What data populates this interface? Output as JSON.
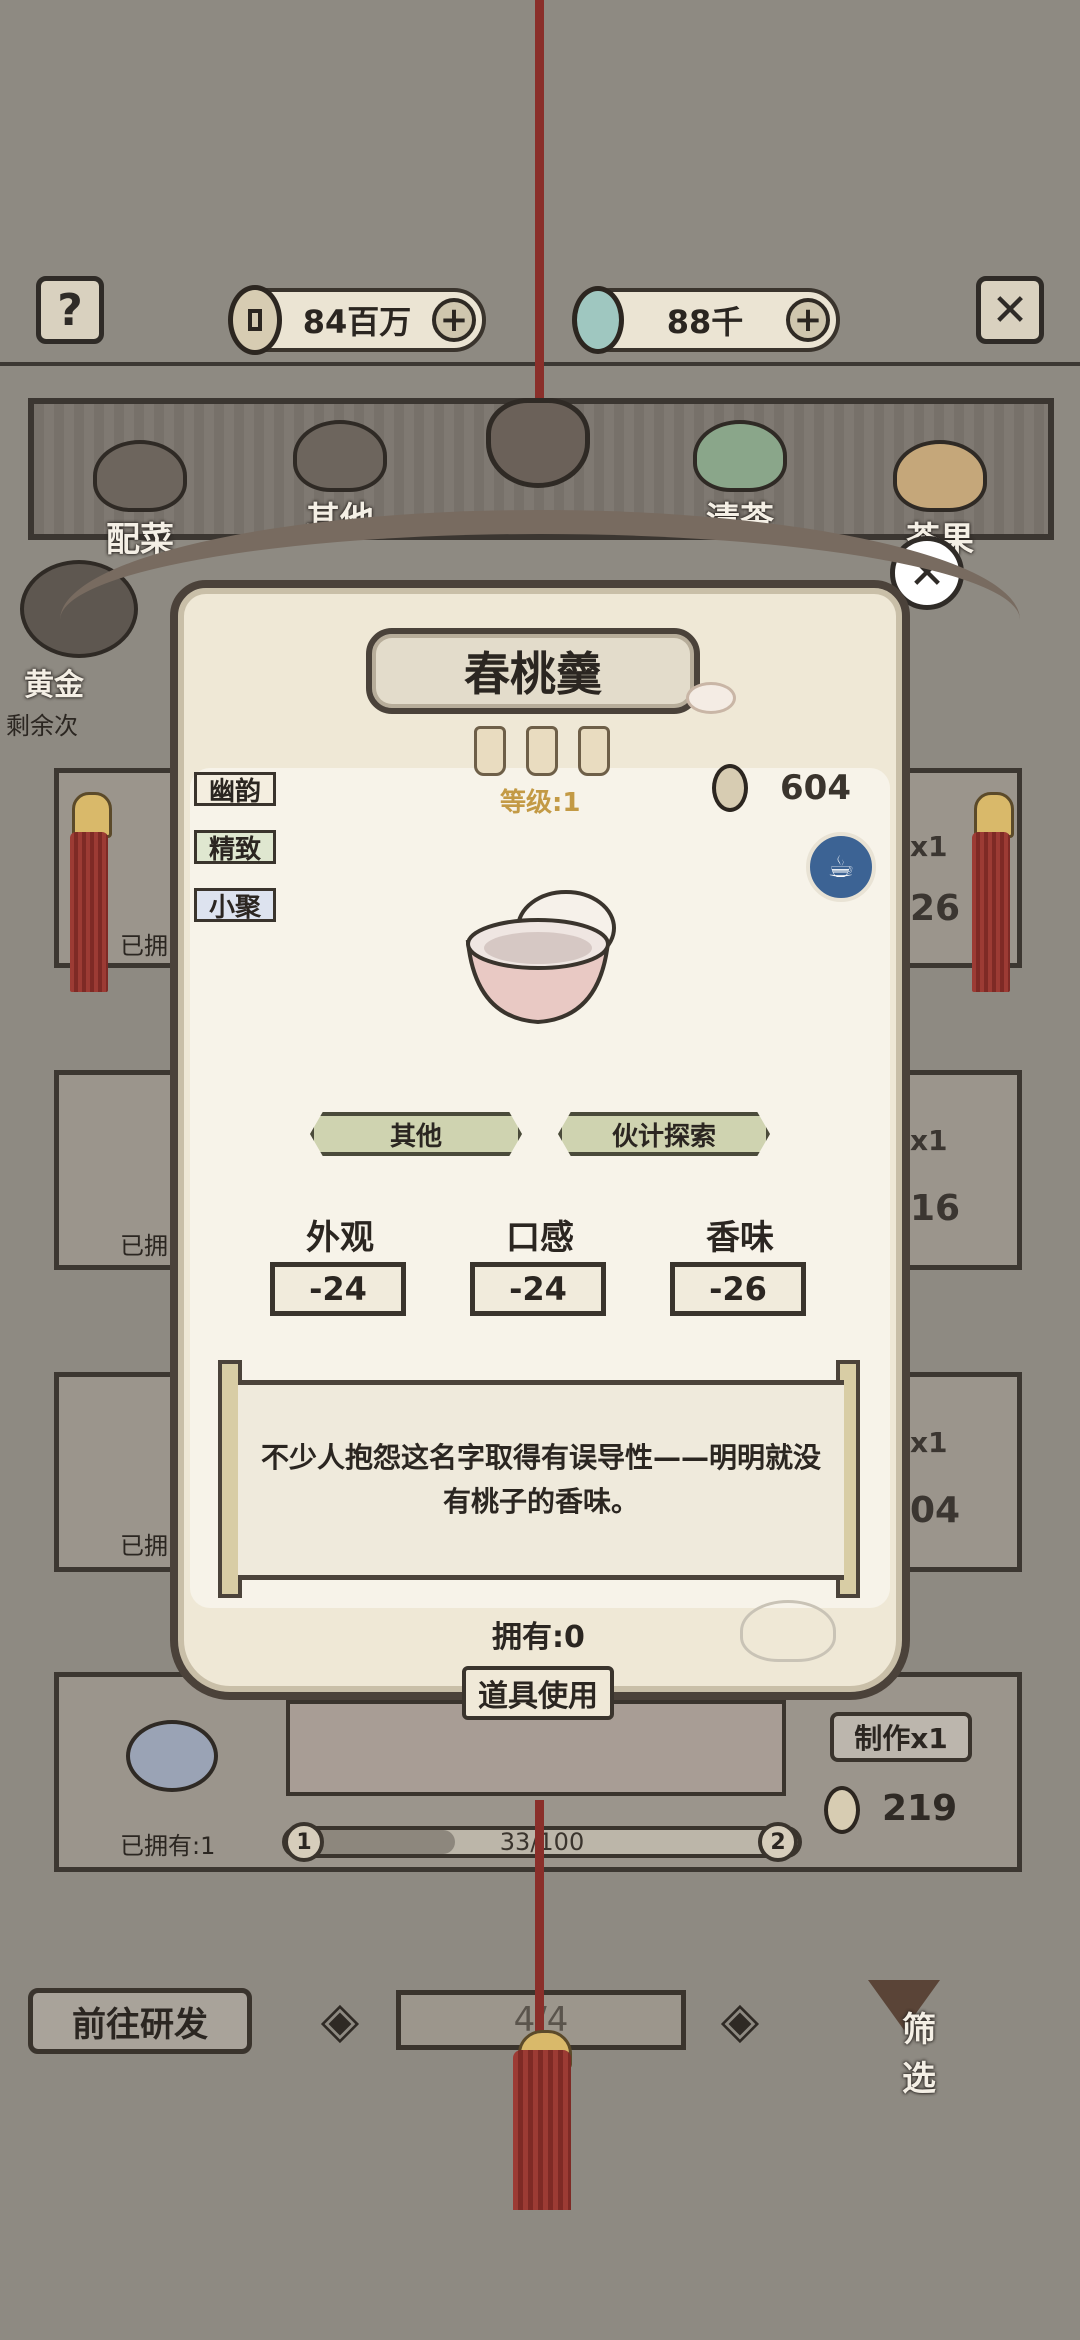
{
  "currency": {
    "coins": "84百万",
    "jade": "88千"
  },
  "categories": [
    {
      "label": "配菜",
      "icon": "side-dish-icon"
    },
    {
      "label": "其他",
      "icon": "mortar-icon"
    },
    {
      "label": "清茶",
      "icon": "tea-pot-icon"
    },
    {
      "label": "茶果",
      "icon": "tea-snack-icon"
    }
  ],
  "background_list": {
    "gold_label": "黄金",
    "remaining_label": "剩余次",
    "rows": [
      {
        "owned": "已拥",
        "count": "x1",
        "price": "26"
      },
      {
        "owned": "已拥",
        "count": "x1",
        "price": "16"
      },
      {
        "owned": "已拥",
        "count": "x1",
        "price": "04"
      }
    ]
  },
  "modal": {
    "title": "春桃羹",
    "tags": [
      "幽韵",
      "精致",
      "小聚"
    ],
    "level": "等级:1",
    "price": "604",
    "sources": [
      "其他",
      "伙计探索"
    ],
    "stats": [
      {
        "label": "外观",
        "value": "-24"
      },
      {
        "label": "口感",
        "value": "-24"
      },
      {
        "label": "香味",
        "value": "-26"
      }
    ],
    "description": "不少人抱怨这名字取得有误导性——明明就没有桃子的香味。",
    "owned": "拥有:0",
    "use_button": "道具使用"
  },
  "bottom_card": {
    "owned": "已拥有:1",
    "make_button": "制作x1",
    "price": "219",
    "progress_text": "33/100",
    "progress": 0.33,
    "level_from": "1",
    "level_to": "2"
  },
  "nav": {
    "research_button": "前往研发",
    "page": "4/4",
    "filter": "筛选"
  },
  "colors": {
    "background": "#8e8a82",
    "rope": "#8a2f2a",
    "level_gold": "#c39a45",
    "badge_blue": "#3c6394"
  }
}
